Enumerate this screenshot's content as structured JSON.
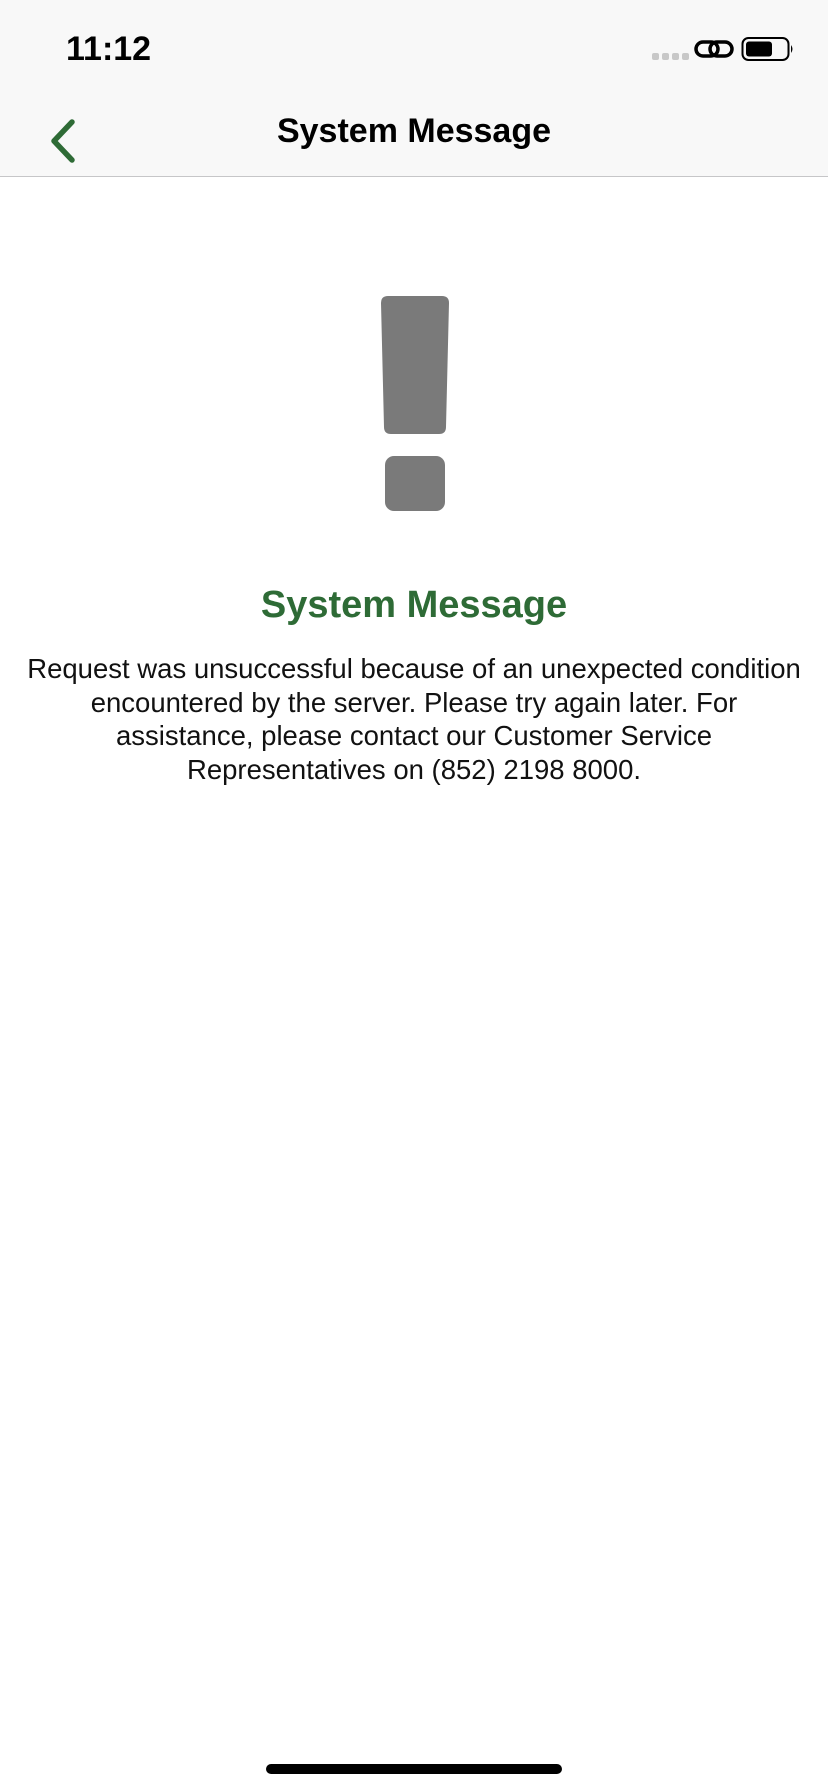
{
  "status_bar": {
    "time": "11:12",
    "icons": [
      "signal-icon",
      "link-icon",
      "battery-icon"
    ]
  },
  "nav": {
    "back_icon": "chevron-left-icon",
    "title": "System Message"
  },
  "content": {
    "icon": "exclamation-icon",
    "heading": "System Message",
    "body": "Request was unsuccessful because of an unexpected condition encountered by the server. Please try again later. For assistance, please contact our Customer Service Representatives on (852) 2198 8000."
  },
  "colors": {
    "accent": "#2e6b36",
    "icon_gray": "#7a7a7a",
    "bar_background": "#f8f8f8"
  }
}
